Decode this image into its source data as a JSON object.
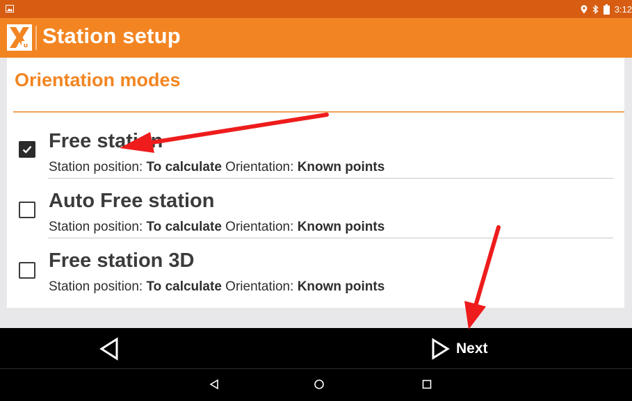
{
  "status_bar": {
    "time": "3:12",
    "icons": [
      "image-icon",
      "location-icon",
      "bluetooth-icon",
      "battery-icon"
    ]
  },
  "app_bar": {
    "title": "Station setup",
    "logo": "xu-logo-icon"
  },
  "card": {
    "title": "Orientation modes",
    "items": [
      {
        "name": "Free station",
        "checked": true,
        "position_label": "Station position:",
        "position_value": "To calculate",
        "orientation_label": "Orientation:",
        "orientation_value": "Known points"
      },
      {
        "name": "Auto Free station",
        "checked": false,
        "position_label": "Station position:",
        "position_value": "To calculate",
        "orientation_label": "Orientation:",
        "orientation_value": "Known points"
      },
      {
        "name": "Free station 3D",
        "checked": false,
        "position_label": "Station position:",
        "position_value": "To calculate",
        "orientation_label": "Orientation:",
        "orientation_value": "Known points"
      }
    ]
  },
  "action_bar": {
    "back_icon": "triangle-back-icon",
    "next_label": "Next"
  },
  "nav_bar": {
    "icons": [
      "nav-back-icon",
      "nav-home-icon",
      "nav-recents-icon"
    ]
  },
  "colors": {
    "status_bar": "#d65d12",
    "app_bar": "#f28522",
    "accent_text": "#f28522",
    "annotation_arrow": "#ee1c1c"
  }
}
